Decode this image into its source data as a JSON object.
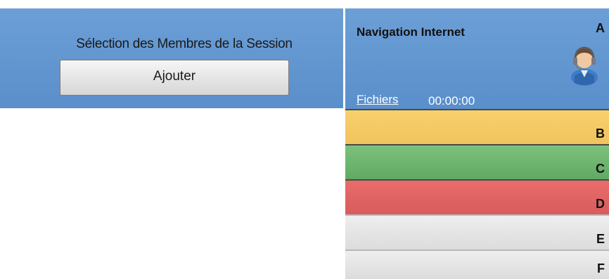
{
  "session": {
    "title": "Sélection des Membres de la Session",
    "add_label": "Ajouter"
  },
  "members": [
    {
      "letter": "A",
      "activity": "Navigation Internet",
      "files_label": "Fichiers",
      "timer": "00:00:00",
      "color": "#6c9fd6",
      "avatar_icon": "user-avatar-icon"
    },
    {
      "letter": "B",
      "color": "#f2c461"
    },
    {
      "letter": "C",
      "color": "#6bb46f"
    },
    {
      "letter": "D",
      "color": "#e06464"
    },
    {
      "letter": "E",
      "color": "#e3e3e3"
    },
    {
      "letter": "F",
      "color": "#e3e3e3"
    }
  ]
}
